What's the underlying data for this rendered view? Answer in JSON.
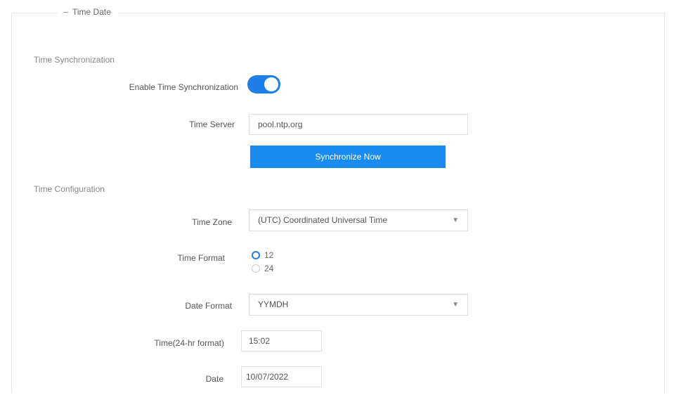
{
  "panel": {
    "legend": "Time Date"
  },
  "sync": {
    "section_title": "Time Synchronization",
    "enable_label": "Enable Time Synchronization",
    "enabled": true,
    "server_label": "Time Server",
    "server_value": "pool.ntp.org",
    "sync_button": "Synchronize Now"
  },
  "config": {
    "section_title": "Time Configuration",
    "zone_label": "Time Zone",
    "zone_value": "(UTC) Coordinated Universal Time",
    "format_label": "Time Format",
    "format_options": [
      "12",
      "24"
    ],
    "format_selected": "12",
    "date_format_label": "Date Format",
    "date_format_value": "YYMDH",
    "time_label": "Time(24-hr format)",
    "time_value": "15:02",
    "date_label": "Date",
    "date_value": "10/07/2022"
  },
  "colors": {
    "accent": "#1e7fe8",
    "button": "#1a8cf0"
  },
  "icons": {
    "select_caret": "chevron-down-icon",
    "legend_dash": "collapse-dash-icon"
  }
}
